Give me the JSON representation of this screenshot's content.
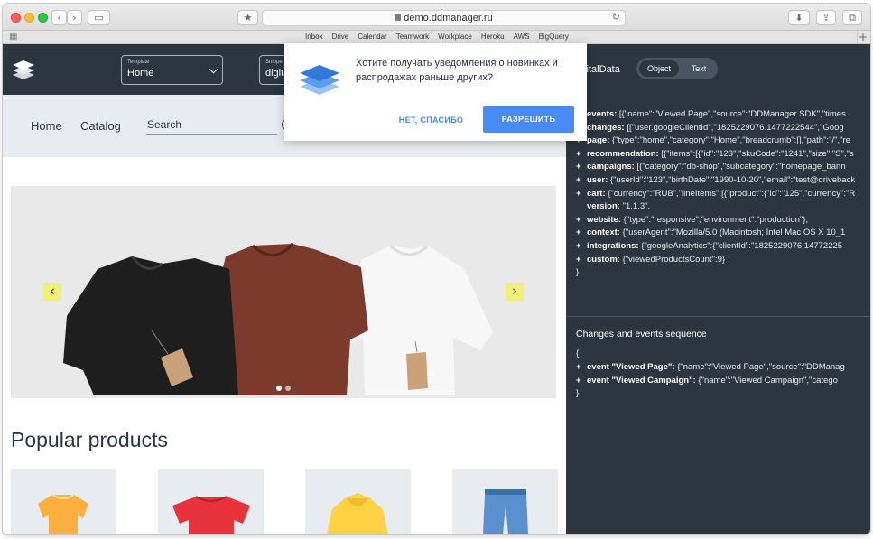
{
  "browser": {
    "url": "demo.ddmanager.ru",
    "bookmarks": [
      "Inbox",
      "Drive",
      "Calendar",
      "Teamwork",
      "Workplace",
      "Heroku",
      "AWS",
      "BigQuery"
    ],
    "colors": {
      "close": "#fc5f57",
      "minimize": "#fdbc2e",
      "maximize": "#29c840"
    }
  },
  "site": {
    "template_caption": "Template",
    "template_value": "Home",
    "snippet_caption": "Snippet",
    "snippet_value": "digita",
    "nav": {
      "home": "Home",
      "catalog": "Catalog",
      "search_placeholder": "Search"
    },
    "carousel": {
      "active_slide": 1,
      "slide_count": 2
    },
    "popular_title": "Popular products",
    "colors": {
      "header": "#2c3540",
      "nav_bg": "#e8ecf1",
      "arrow": "#f2ef7a"
    }
  },
  "popup": {
    "message": "Хотите получать уведомления о новинках и распродажах раньше других?",
    "decline": "НЕТ, СПАСИБО",
    "accept": "РАЗРЕШИТЬ",
    "accent": "#4a8af4"
  },
  "panel": {
    "title": "igitalData",
    "tabs": {
      "object": "Object",
      "text": "Text",
      "active": "Object"
    },
    "object_open": "{",
    "object_close": "}",
    "entries": [
      {
        "expandable": true,
        "key": "events",
        "value": "[{\"name\":\"Viewed Page\",\"source\":\"DDManager SDK\",\"times"
      },
      {
        "expandable": true,
        "key": "changes",
        "value": "[[\"user.googleClientId\",\"1825229076.1477222544\",\"Goog"
      },
      {
        "expandable": true,
        "key": "page",
        "value": "{\"type\":\"home\",\"category\":\"Home\",\"breadcrumb\":[],\"path\":\"/\",\"re"
      },
      {
        "expandable": true,
        "key": "recommendation",
        "value": "[{\"items\":[{\"id\":\"123\",\"skuCode\":\"1241\",\"size\":\"S\",\"s"
      },
      {
        "expandable": true,
        "key": "campaigns",
        "value": "[{\"category\":\"db-shop\",\"subcategory\":\"homepage_bann"
      },
      {
        "expandable": true,
        "key": "user",
        "value": "{\"userId\":\"123\",\"birthDate\":\"1990-10-20\",\"email\":\"test@driveback"
      },
      {
        "expandable": true,
        "key": "cart",
        "value": "{\"currency\":\"RUB\",\"lineItems\":[{\"product\":{\"id\":\"125\",\"currency\":\"R"
      },
      {
        "expandable": false,
        "key": "version",
        "value": "\"1.1.3\","
      },
      {
        "expandable": true,
        "key": "website",
        "value": "{\"type\":\"responsive\",\"environment\":\"production\"},"
      },
      {
        "expandable": true,
        "key": "context",
        "value": "{\"userAgent\":\"Mozilla/5.0 (Macintosh; Intel Mac OS X 10_1"
      },
      {
        "expandable": true,
        "key": "integrations",
        "value": "{\"googleAnalytics\":{\"clientId\":\"1825229076.14772225"
      },
      {
        "expandable": true,
        "key": "custom",
        "value": "{\"viewedProductsCount\":9}"
      }
    ],
    "sequence_title": "Changes and events sequence",
    "sequence_open": "{",
    "sequence_close": "}",
    "events": [
      {
        "key": "event \"Viewed Page\"",
        "value": "{\"name\":\"Viewed Page\",\"source\":\"DDManag"
      },
      {
        "key": "event \"Viewed Campaign\"",
        "value": "{\"name\":\"Viewed Campaign\",\"catego"
      }
    ],
    "colors": {
      "bg": "#2c3540",
      "segment": "#485563"
    }
  }
}
